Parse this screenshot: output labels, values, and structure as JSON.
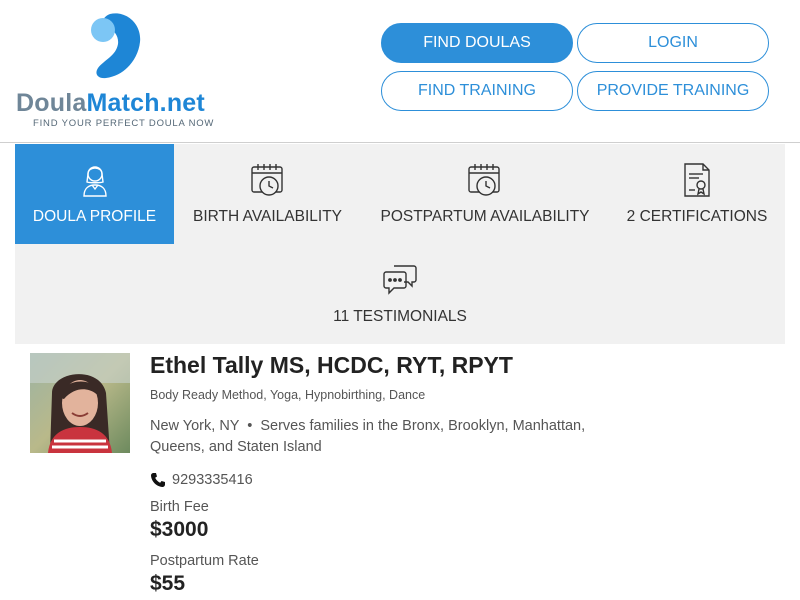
{
  "site": {
    "logo_part1": "Doula",
    "logo_part2": "Match.net",
    "tagline": "FIND YOUR PERFECT DOULA NOW"
  },
  "nav": {
    "find_doulas": "FIND DOULAS",
    "login": "LOGIN",
    "find_training": "FIND TRAINING",
    "provide_training": "PROVIDE TRAINING"
  },
  "tabs": [
    {
      "label": "DOULA PROFILE",
      "icon": "doula-avatar-icon",
      "active": true
    },
    {
      "label": "BIRTH AVAILABILITY",
      "icon": "calendar-clock-icon",
      "active": false
    },
    {
      "label": "POSTPARTUM AVAILABILITY",
      "icon": "calendar-clock-icon",
      "active": false
    },
    {
      "label": "2 CERTIFICATIONS",
      "icon": "certificate-icon",
      "active": false
    },
    {
      "label": "11 TESTIMONIALS",
      "icon": "chat-bubbles-icon",
      "active": false
    }
  ],
  "profile": {
    "name": "Ethel Tally MS, HCDC, RYT, RPYT",
    "methods": "Body Ready Method, Yoga, Hypnobirthing, Dance",
    "city": "New York, NY",
    "service_area": "Serves families in the Bronx, Brooklyn, Manhattan, Queens, and Staten Island",
    "phone": "9293335416",
    "birth_fee_label": "Birth Fee",
    "birth_fee": "$3000",
    "postpartum_rate_label": "Postpartum Rate",
    "postpartum_rate": "$55"
  },
  "colors": {
    "accent": "#2d8fd9",
    "logo_blue": "#1e86d6",
    "logo_gray": "#6f8698",
    "tab_bg": "#f1f1f1"
  }
}
